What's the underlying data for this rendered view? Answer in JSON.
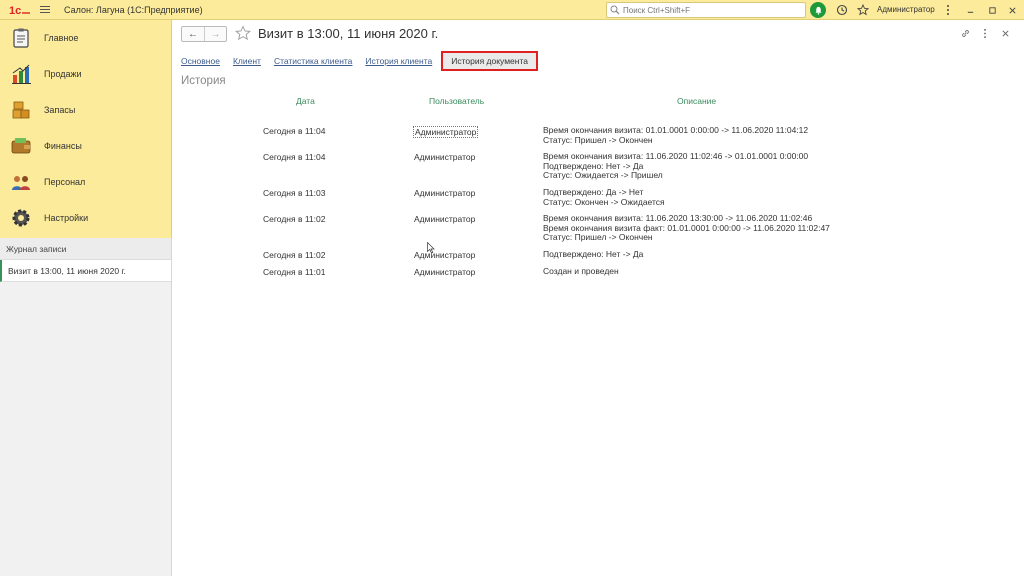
{
  "app": {
    "title": "Салон: Лагуна  (1С:Предприятие)",
    "search_placeholder": "Поиск Ctrl+Shift+F",
    "user": "Администратор"
  },
  "sidebar": {
    "items": [
      {
        "label": "Главное",
        "icon": "clipboard-icon"
      },
      {
        "label": "Продажи",
        "icon": "bar-chart-icon"
      },
      {
        "label": "Запасы",
        "icon": "boxes-icon"
      },
      {
        "label": "Финансы",
        "icon": "wallet-icon"
      },
      {
        "label": "Персонал",
        "icon": "people-icon"
      },
      {
        "label": "Настройки",
        "icon": "gear-icon"
      }
    ],
    "journal_header": "Журнал записи",
    "journal_item": "Визит в 13:00, 11 июня 2020 г."
  },
  "document": {
    "title": "Визит в 13:00, 11 июня 2020 г.",
    "tabs": [
      "Основное",
      "Клиент",
      "Статистика клиента",
      "История клиента",
      "История документа"
    ],
    "active_tab": "История документа",
    "section_title": "История",
    "columns": {
      "date": "Дата",
      "user": "Пользователь",
      "desc": "Описание"
    },
    "rows": [
      {
        "date": "Сегодня в 11:04",
        "user": "Администратор",
        "desc": [
          "Время окончания визита: 01.01.0001 0:00:00 -> 11.06.2020 11:04:12",
          "Статус: Пришел -> Окончен"
        ]
      },
      {
        "date": "Сегодня в 11:04",
        "user": "Администратор",
        "desc": [
          "Время окончания визита: 11.06.2020 11:02:46 -> 01.01.0001 0:00:00",
          "Подтверждено: Нет -> Да",
          "Статус: Ожидается -> Пришел"
        ]
      },
      {
        "date": "Сегодня в 11:03",
        "user": "Администратор",
        "desc": [
          "Подтверждено: Да -> Нет",
          "Статус: Окончен -> Ожидается"
        ]
      },
      {
        "date": "Сегодня в 11:02",
        "user": "Администратор",
        "desc": [
          "Время окончания визита: 11.06.2020 13:30:00 -> 11.06.2020 11:02:46",
          "Время окончания визита факт: 01.01.0001 0:00:00 -> 11.06.2020 11:02:47",
          "Статус: Пришел -> Окончен"
        ]
      },
      {
        "date": "Сегодня в 11:02",
        "user": "Администратор",
        "desc": [
          "Подтверждено: Нет -> Да"
        ]
      },
      {
        "date": "Сегодня в 11:01",
        "user": "Администратор",
        "desc": [
          "Создан и проведен"
        ]
      }
    ]
  }
}
